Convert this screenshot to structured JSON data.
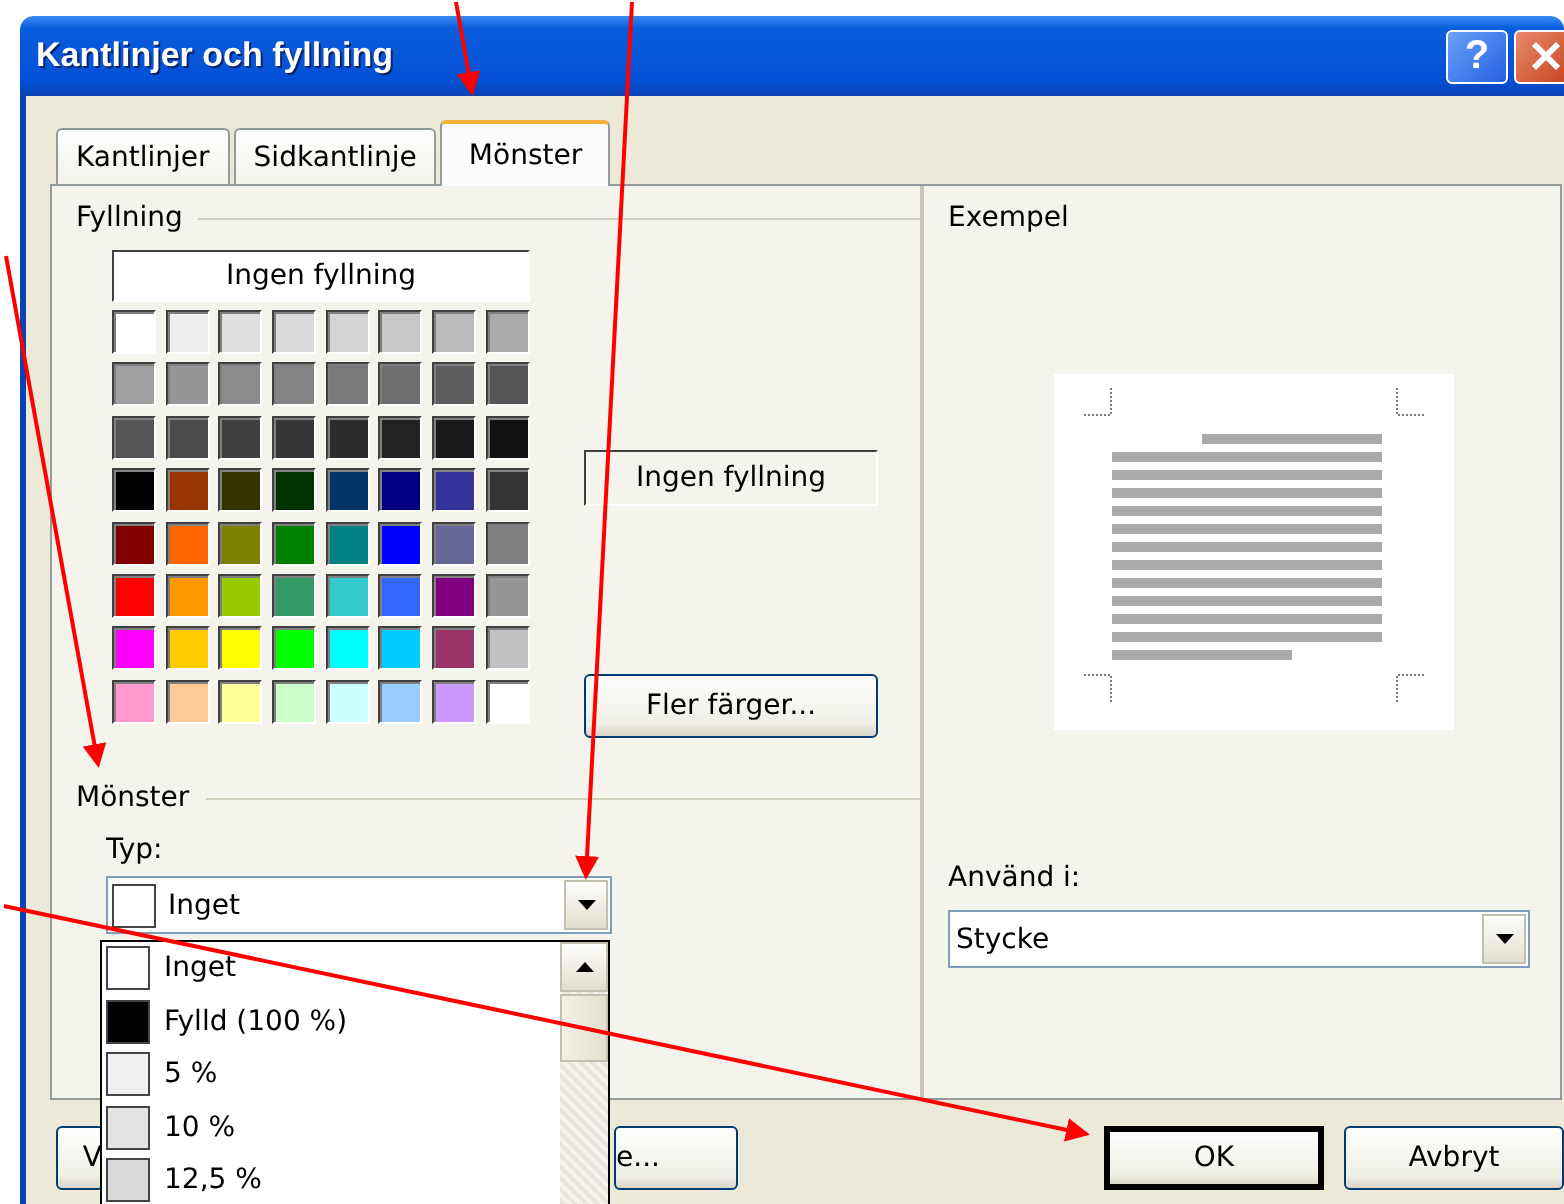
{
  "window": {
    "title": "Kantlinjer och fyllning",
    "help": "?"
  },
  "tabs": [
    {
      "label": "Kantlinjer",
      "selected": false
    },
    {
      "label": "Sidkantlinje",
      "selected": false
    },
    {
      "label": "Mönster",
      "selected": true
    }
  ],
  "fill": {
    "legend": "Fyllning",
    "none_label": "Ingen fyllning",
    "current": "Ingen fyllning",
    "more_button": "Fler färger...",
    "palette": [
      {
        "color": "#ffffff"
      },
      {
        "color": "#eeeeee"
      },
      {
        "color": "#e0e0e0"
      },
      {
        "color": "#dadada"
      },
      {
        "color": "#d4d4d4"
      },
      {
        "color": "#c8c8c8"
      },
      {
        "color": "#bbbbbb"
      },
      {
        "color": "#aaaaaa"
      },
      {
        "color": "#a0a0a0"
      },
      {
        "color": "#969696"
      },
      {
        "color": "#8c8c8c"
      },
      {
        "color": "#848484"
      },
      {
        "color": "#7a7a7a"
      },
      {
        "color": "#6e6e6e"
      },
      {
        "color": "#5e5e5e"
      },
      {
        "color": "#555555"
      },
      {
        "color": "#555555"
      },
      {
        "color": "#4a4a4a"
      },
      {
        "color": "#404040"
      },
      {
        "color": "#363636"
      },
      {
        "color": "#2c2c2c"
      },
      {
        "color": "#222222"
      },
      {
        "color": "#1a1a1a"
      },
      {
        "color": "#111111"
      },
      {
        "color": "#000000"
      },
      {
        "color": "#993300"
      },
      {
        "color": "#333300"
      },
      {
        "color": "#003300"
      },
      {
        "color": "#003366"
      },
      {
        "color": "#000080"
      },
      {
        "color": "#333399"
      },
      {
        "color": "#333333"
      },
      {
        "color": "#800000"
      },
      {
        "color": "#ff6600"
      },
      {
        "color": "#808000"
      },
      {
        "color": "#008000"
      },
      {
        "color": "#008080"
      },
      {
        "color": "#0000ff"
      },
      {
        "color": "#666699"
      },
      {
        "color": "#808080"
      },
      {
        "color": "#ff0000"
      },
      {
        "color": "#ff9900"
      },
      {
        "color": "#99cc00"
      },
      {
        "color": "#339966"
      },
      {
        "color": "#33cccc"
      },
      {
        "color": "#3366ff"
      },
      {
        "color": "#800080"
      },
      {
        "color": "#969696"
      },
      {
        "color": "#ff00ff"
      },
      {
        "color": "#ffcc00"
      },
      {
        "color": "#ffff00"
      },
      {
        "color": "#00ff00"
      },
      {
        "color": "#00ffff"
      },
      {
        "color": "#00ccff"
      },
      {
        "color": "#993366"
      },
      {
        "color": "#c0c0c0"
      },
      {
        "color": "#ff99cc"
      },
      {
        "color": "#ffcc99"
      },
      {
        "color": "#ffff99"
      },
      {
        "color": "#ccffcc"
      },
      {
        "color": "#ccffff"
      },
      {
        "color": "#99ccff"
      },
      {
        "color": "#cc99ff"
      },
      {
        "color": "#ffffff"
      }
    ]
  },
  "pattern": {
    "legend": "Mönster",
    "type_label": "Typ:",
    "value": {
      "label": "Inget",
      "color": "#ffffff"
    },
    "expanded": true,
    "options": [
      {
        "label": "Inget",
        "color": "#ffffff"
      },
      {
        "label": "Fylld (100 %)",
        "color": "#000000"
      },
      {
        "label": "5 %",
        "color": "#f0f0f0"
      },
      {
        "label": "10 %",
        "color": "#e4e4e4"
      },
      {
        "label": "12,5 %",
        "color": "#dadada"
      }
    ]
  },
  "preview": {
    "legend": "Exempel"
  },
  "apply": {
    "label": "Använd i:",
    "value": "Stycke"
  },
  "buttons": [
    {
      "label": "V",
      "kind": "covered-left",
      "default": false
    },
    {
      "label": "e...",
      "kind": "covered-right",
      "default": false
    },
    {
      "label": "OK",
      "kind": "normal",
      "default": true
    },
    {
      "label": "Avbryt",
      "kind": "normal",
      "default": false
    }
  ]
}
